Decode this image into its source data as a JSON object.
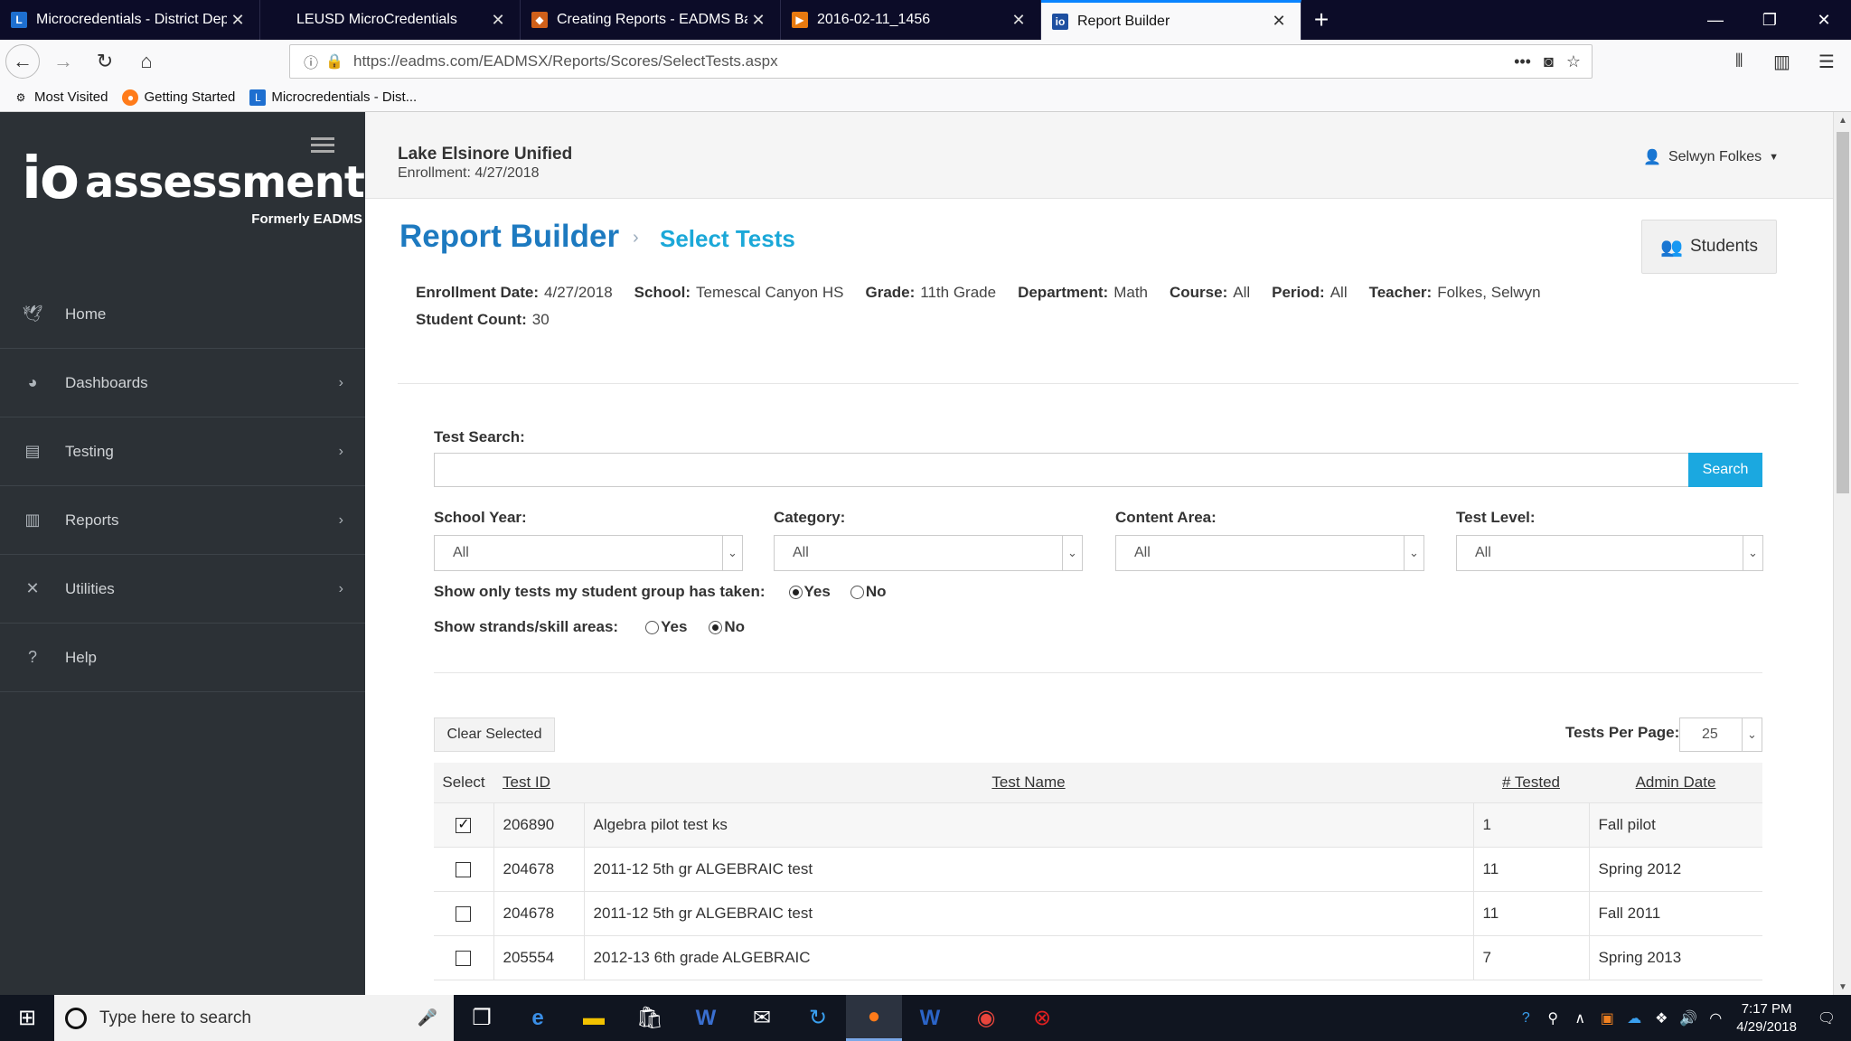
{
  "browser": {
    "tabs": [
      {
        "title": "Microcredentials - District Dep",
        "favicon": "L",
        "favicon_color": "#1e6fd0"
      },
      {
        "title": "LEUSD MicroCredentials",
        "favicon": "",
        "favicon_color": ""
      },
      {
        "title": "Creating Reports - EADMS Basi",
        "favicon": "◆",
        "favicon_color": "#d0601a"
      },
      {
        "title": "2016-02-11_1456",
        "favicon": "▶",
        "favicon_color": "#e87a10"
      },
      {
        "title": "Report Builder",
        "favicon": "io",
        "favicon_color": "#1d4fa0"
      }
    ],
    "active_tab_index": 4,
    "url_domain": "https://eadms.com",
    "url_path": "/EADMSX/Reports/Scores/SelectTests.aspx",
    "bookmarks": [
      {
        "label": "Most Visited",
        "icon": "gear-icon"
      },
      {
        "label": "Getting Started",
        "icon": "firefox-icon"
      },
      {
        "label": "Microcredentials - Dist...",
        "icon": "l-icon"
      }
    ]
  },
  "sidebar": {
    "logo_mark": "io",
    "logo_word": "assessment",
    "logo_sub": "Formerly EADMS",
    "items": [
      {
        "label": "Home",
        "icon": "🕊",
        "has_children": false
      },
      {
        "label": "Dashboards",
        "icon": "◕",
        "has_children": true
      },
      {
        "label": "Testing",
        "icon": "▤",
        "has_children": true
      },
      {
        "label": "Reports",
        "icon": "▥",
        "has_children": true
      },
      {
        "label": "Utilities",
        "icon": "✕",
        "has_children": true
      },
      {
        "label": "Help",
        "icon": "?",
        "has_children": false
      }
    ]
  },
  "header": {
    "district": "Lake Elsinore Unified",
    "enrollment": "Enrollment: 4/27/2018",
    "user": "Selwyn Folkes"
  },
  "page": {
    "title": "Report Builder",
    "subtitle": "Select Tests",
    "students_button": "Students",
    "info": [
      {
        "label": "Enrollment Date:",
        "value": "4/27/2018"
      },
      {
        "label": "School:",
        "value": "Temescal Canyon HS"
      },
      {
        "label": "Grade:",
        "value": "11th Grade"
      },
      {
        "label": "Department:",
        "value": "Math"
      },
      {
        "label": "Course:",
        "value": "All"
      },
      {
        "label": "Period:",
        "value": "All"
      },
      {
        "label": "Teacher:",
        "value": "Folkes, Selwyn"
      }
    ],
    "student_count_label": "Student Count:",
    "student_count": "30"
  },
  "filters": {
    "test_search_label": "Test Search:",
    "search_value": "",
    "search_button": "Search",
    "school_year_label": "School Year:",
    "school_year": "All",
    "category_label": "Category:",
    "category": "All",
    "content_area_label": "Content Area:",
    "content_area": "All",
    "test_level_label": "Test Level:",
    "test_level": "All",
    "taken_label": "Show only tests my student group has taken:",
    "taken_yes": "Yes",
    "taken_no": "No",
    "taken_selected": "Yes",
    "strands_label": "Show strands/skill areas:",
    "strands_yes": "Yes",
    "strands_no": "No",
    "strands_selected": "No"
  },
  "table": {
    "clear_button": "Clear Selected",
    "per_page_label": "Tests Per Page:",
    "per_page": "25",
    "columns": {
      "select": "Select",
      "test_id": "Test ID",
      "test_name": "Test Name",
      "tested": "# Tested",
      "admin_date": "Admin Date"
    },
    "rows": [
      {
        "selected": true,
        "test_id": "206890",
        "test_name": "Algebra pilot test ks",
        "tested": "1",
        "admin_date": "Fall pilot"
      },
      {
        "selected": false,
        "test_id": "204678",
        "test_name": "2011-12 5th gr ALGEBRAIC test",
        "tested": "11",
        "admin_date": "Spring 2012"
      },
      {
        "selected": false,
        "test_id": "204678",
        "test_name": "2011-12 5th gr ALGEBRAIC test",
        "tested": "11",
        "admin_date": "Fall 2011"
      },
      {
        "selected": false,
        "test_id": "205554",
        "test_name": "2012-13 6th grade ALGEBRAIC",
        "tested": "7",
        "admin_date": "Spring 2013"
      }
    ]
  },
  "taskbar": {
    "search_placeholder": "Type here to search",
    "time": "7:17 PM",
    "date": "4/29/2018"
  }
}
